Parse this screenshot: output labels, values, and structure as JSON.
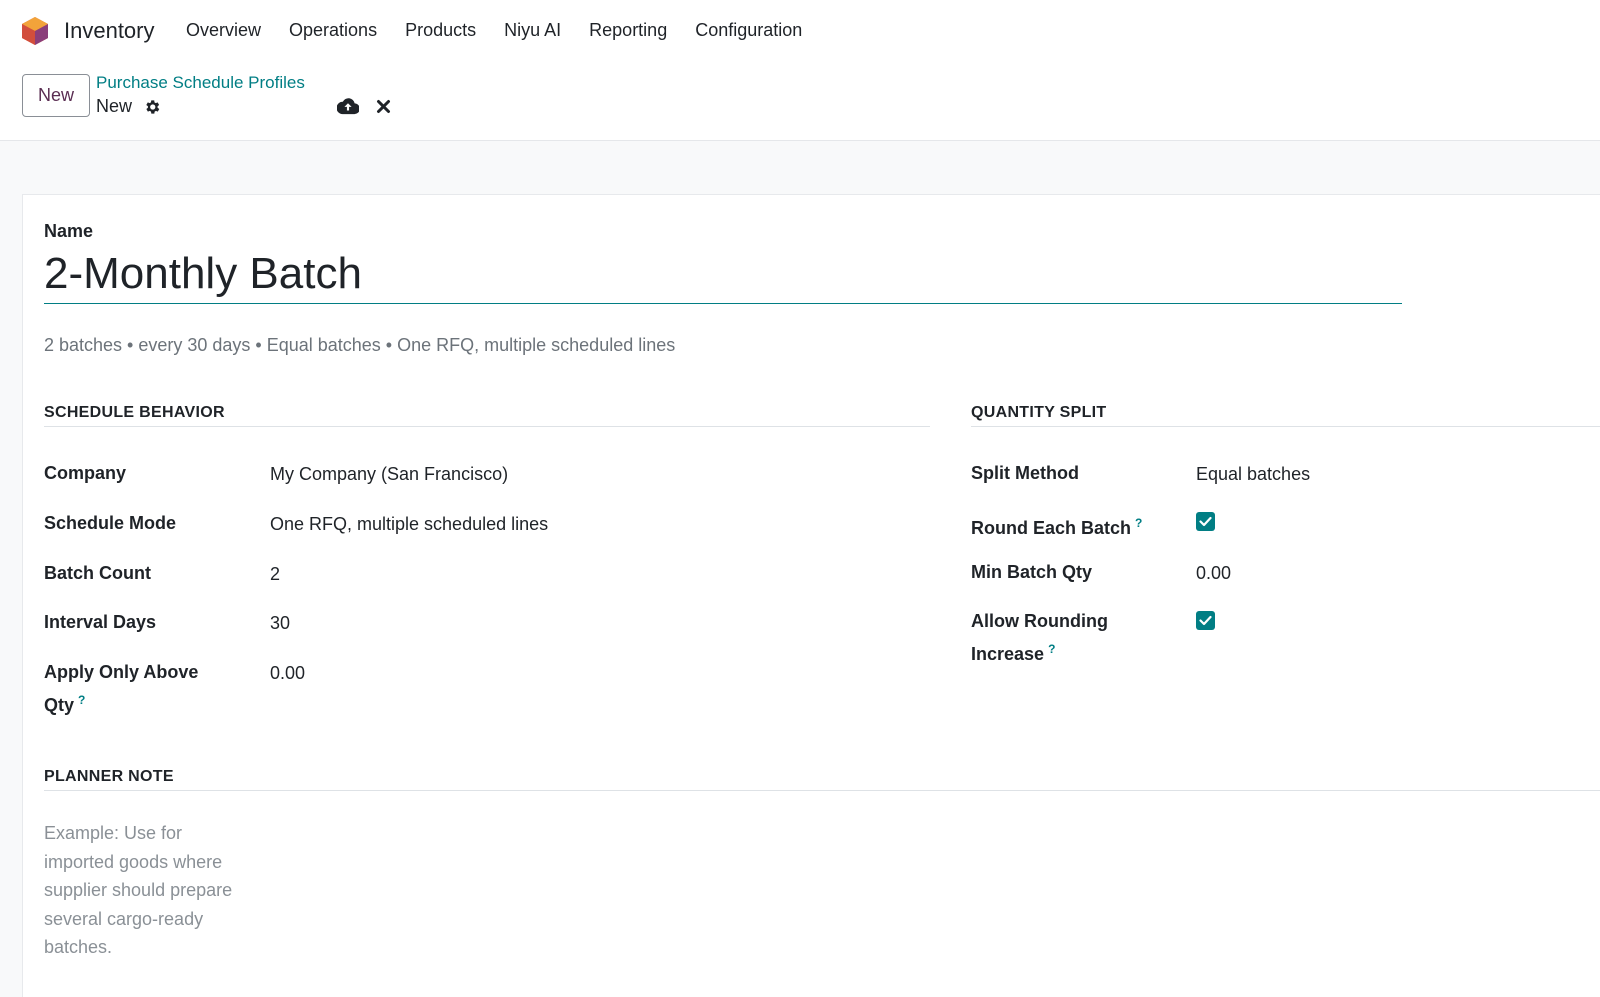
{
  "app": {
    "name": "Inventory",
    "menu": [
      "Overview",
      "Operations",
      "Products",
      "Niyu AI",
      "Reporting",
      "Configuration"
    ]
  },
  "control_panel": {
    "new_label": "New",
    "breadcrumb_parent": "Purchase Schedule Profiles",
    "breadcrumb_current": "New"
  },
  "form": {
    "name_label": "Name",
    "name_value": "2-Monthly Batch",
    "summary": "2 batches • every 30 days • Equal batches • One RFQ, multiple scheduled lines",
    "schedule_behavior": {
      "title": "SCHEDULE BEHAVIOR",
      "fields": [
        {
          "label": "Company",
          "value": "My Company (San Francisco)"
        },
        {
          "label": "Schedule Mode",
          "value": "One RFQ, multiple scheduled lines"
        },
        {
          "label": "Batch Count",
          "value": "2"
        },
        {
          "label": "Interval Days",
          "value": "30"
        },
        {
          "label_line1": "Apply Only Above",
          "label_line2": "Qty",
          "help": "?",
          "value": "0.00"
        }
      ]
    },
    "quantity_split": {
      "title": "QUANTITY SPLIT",
      "split_method": {
        "label": "Split Method",
        "value": "Equal batches"
      },
      "round_each_batch": {
        "label": "Round Each Batch",
        "help": "?",
        "checked": true
      },
      "min_batch_qty": {
        "label": "Min Batch Qty",
        "value": "0.00"
      },
      "allow_rounding_increase": {
        "label_line1": "Allow Rounding",
        "label_line2": "Increase",
        "help": "?",
        "checked": true
      }
    },
    "planner_note": {
      "title": "PLANNER NOTE",
      "placeholder": "Example: Use for imported goods where supplier should prepare several cargo-ready batches."
    }
  },
  "colors": {
    "accent": "#017e84",
    "brand": "#5a2d52"
  }
}
